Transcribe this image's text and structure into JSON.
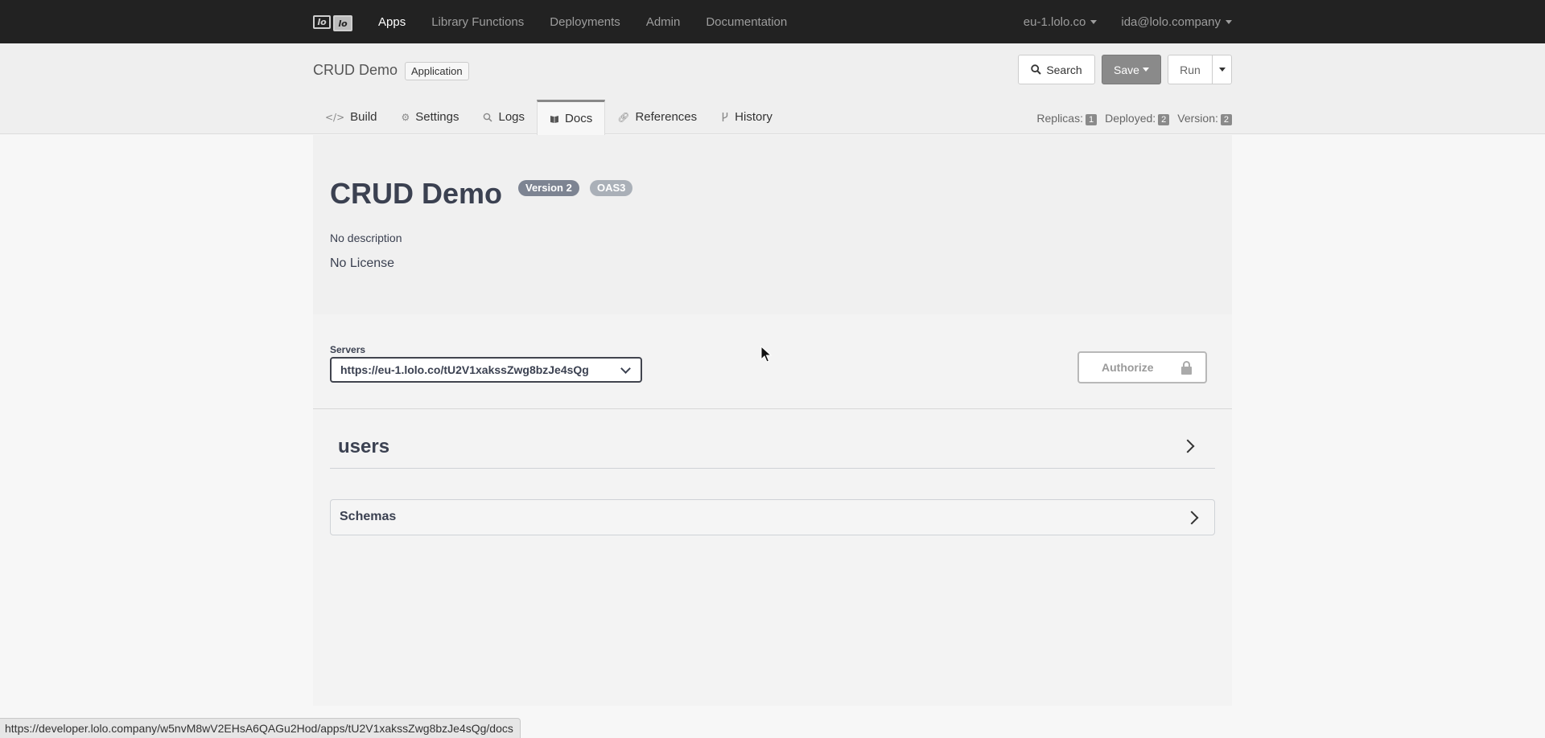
{
  "navbar": {
    "logo_text_1": "lo",
    "logo_text_2": "lo",
    "links": [
      "Apps",
      "Library Functions",
      "Deployments",
      "Admin",
      "Documentation"
    ],
    "region": "eu-1.lolo.co",
    "user": "ida@lolo.company"
  },
  "subheader": {
    "app_title": "CRUD Demo",
    "app_type": "Application",
    "search_label": "Search",
    "save_label": "Save",
    "run_label": "Run",
    "tabs": [
      {
        "label": "Build",
        "icon": "code-icon"
      },
      {
        "label": "Settings",
        "icon": "gear-icon"
      },
      {
        "label": "Logs",
        "icon": "search-icon"
      },
      {
        "label": "Docs",
        "icon": "book-icon"
      },
      {
        "label": "References",
        "icon": "link-icon"
      },
      {
        "label": "History",
        "icon": "branch-icon"
      }
    ],
    "active_tab": "Docs",
    "stats": {
      "replicas_label": "Replicas:",
      "replicas": "1",
      "deployed_label": "Deployed:",
      "deployed": "2",
      "version_label": "Version:",
      "version": "2"
    }
  },
  "docs": {
    "title": "CRUD Demo",
    "version_badge": "Version 2",
    "oas_badge": "OAS3",
    "description": "No description",
    "license": "No License",
    "servers_label": "Servers",
    "server_url": "https://eu-1.lolo.co/tU2V1xakssZwg8bzJe4sQg",
    "authorize_label": "Authorize",
    "sections": {
      "users": "users",
      "schemas": "Schemas"
    }
  },
  "statusbar": {
    "url": "https://developer.lolo.company/w5nvM8wV2EHsA6QAGu2Hod/apps/tU2V1xakssZwg8bzJe4sQg/docs"
  }
}
